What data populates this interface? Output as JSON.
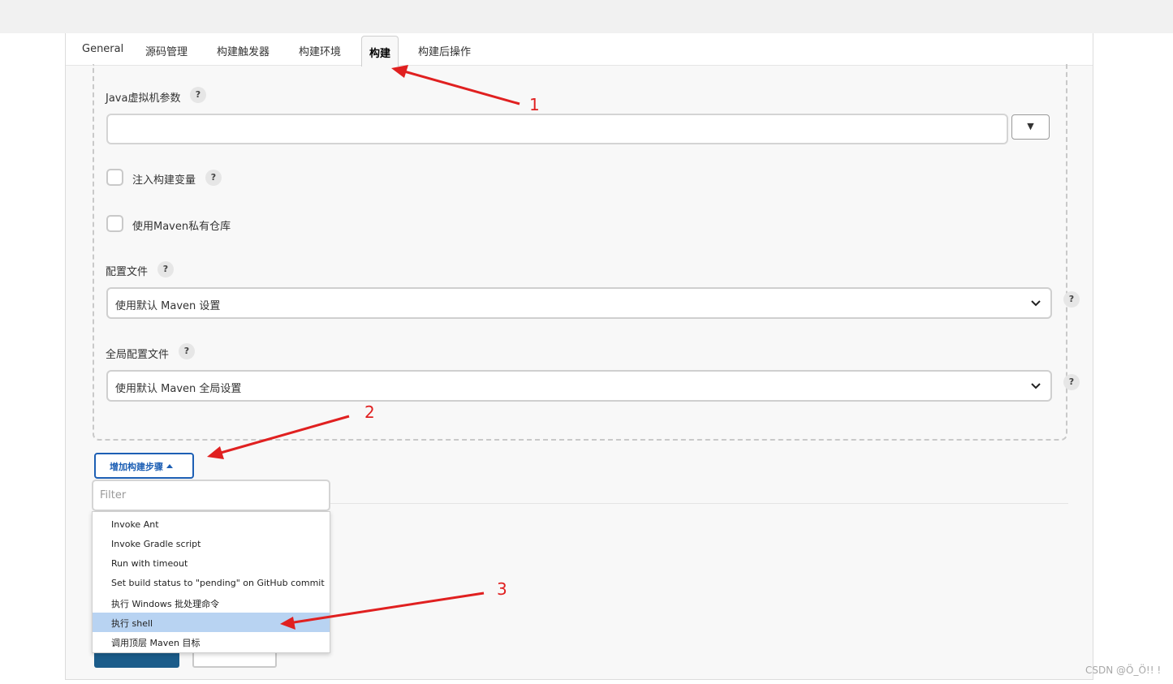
{
  "tabs": [
    {
      "label": "General"
    },
    {
      "label": "源码管理"
    },
    {
      "label": "构建触发器"
    },
    {
      "label": "构建环境"
    },
    {
      "label": "构建"
    },
    {
      "label": "构建后操作"
    }
  ],
  "jvm": {
    "label": "Java虚拟机参数",
    "value": ""
  },
  "options": [
    {
      "label": "注入构建变量"
    },
    {
      "label": "使用Maven私有仓库"
    }
  ],
  "settings": {
    "label": "配置文件",
    "selected": "使用默认 Maven 设置"
  },
  "global_settings": {
    "label": "全局配置文件",
    "selected": "使用默认 Maven 全局设置"
  },
  "help_glyph": "?",
  "add_step": {
    "label": "增加构建步骤"
  },
  "filter": {
    "placeholder": "Filter"
  },
  "menu_items": [
    {
      "label": "Invoke Ant"
    },
    {
      "label": "Invoke Gradle script"
    },
    {
      "label": "Run with timeout"
    },
    {
      "label": "Set build status to \"pending\" on GitHub commit"
    },
    {
      "label": "执行 Windows 批处理命令"
    },
    {
      "label": "执行 shell"
    },
    {
      "label": "调用顶层 Maven 目标"
    }
  ],
  "annotations": [
    "1",
    "2",
    "3"
  ],
  "watermark": "CSDN @Ö_Ö!! !",
  "colors": {
    "accent": "#1d5fb4",
    "highlight": "#b8d3f2",
    "annotation": "#e02020",
    "save": "#1b5c8a"
  }
}
